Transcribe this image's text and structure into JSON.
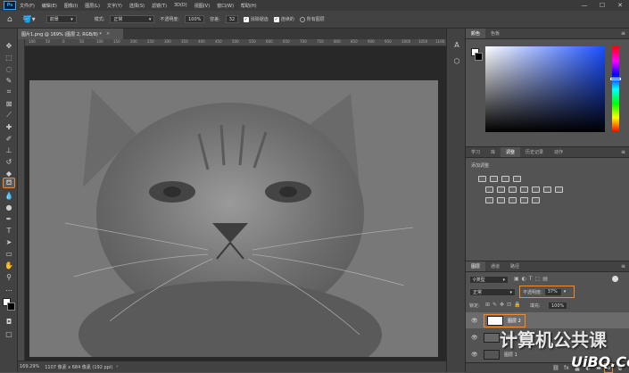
{
  "app": {
    "logo": "Ps"
  },
  "menu": [
    "文件(F)",
    "编辑(E)",
    "图像(I)",
    "图层(L)",
    "文字(Y)",
    "选择(S)",
    "滤镜(T)",
    "3D(D)",
    "视图(V)",
    "窗口(W)",
    "帮助(H)"
  ],
  "window_controls": {
    "minimize": "—",
    "maximize": "☐",
    "close": "✕"
  },
  "options": {
    "preset": "前景",
    "mode_label": "模式:",
    "mode_value": "正常",
    "opacity_label": "不透明度:",
    "opacity_value": "100%",
    "tolerance_label": "容差:",
    "tolerance_value": "32",
    "antialias_label": "消除锯齿",
    "contiguous_label": "连续的",
    "all_layers_label": "所有图层"
  },
  "document": {
    "tab_title": "图片1.png @ 169% (图层 2, RGB/8) *",
    "tab_close": "×"
  },
  "ruler_numbers": [
    "100",
    "50",
    "0",
    "50",
    "100",
    "150",
    "200",
    "250",
    "300",
    "350",
    "400",
    "450",
    "500",
    "550",
    "600",
    "650",
    "700",
    "750",
    "800",
    "850",
    "900",
    "950",
    "1000",
    "1050",
    "1100"
  ],
  "status": {
    "zoom": "169.29%",
    "size": "1107 像素 x 684 像素 (192 ppi)",
    "arrow": "›"
  },
  "color_panel": {
    "tabs": [
      "颜色",
      "色板"
    ],
    "menu": "≡"
  },
  "adjust_panel": {
    "tabs": [
      "学习",
      "库",
      "调整",
      "历史记录",
      "动作"
    ],
    "active": 2,
    "title": "添加调整",
    "menu": "≡"
  },
  "layers_panel": {
    "tabs": [
      "图层",
      "通道",
      "路径"
    ],
    "filter_kind": "类型",
    "blend_mode": "正常",
    "opacity_label": "不透明度:",
    "opacity_value": "37%",
    "lock_label": "锁定:",
    "fill_label": "填充:",
    "fill_value": "100%",
    "layers": [
      {
        "name": "图层 2",
        "selected": true
      },
      {
        "name": "图层 1 拷贝",
        "selected": false
      },
      {
        "name": "图层 1",
        "selected": false
      }
    ],
    "menu": "≡"
  },
  "watermark": {
    "text": "计算机公共课",
    "site": "UiBQ.CoM"
  },
  "colors": {
    "accent": "#f28b30",
    "panel": "#535353",
    "chrome": "#424242",
    "menubar": "#3a3a3a"
  }
}
